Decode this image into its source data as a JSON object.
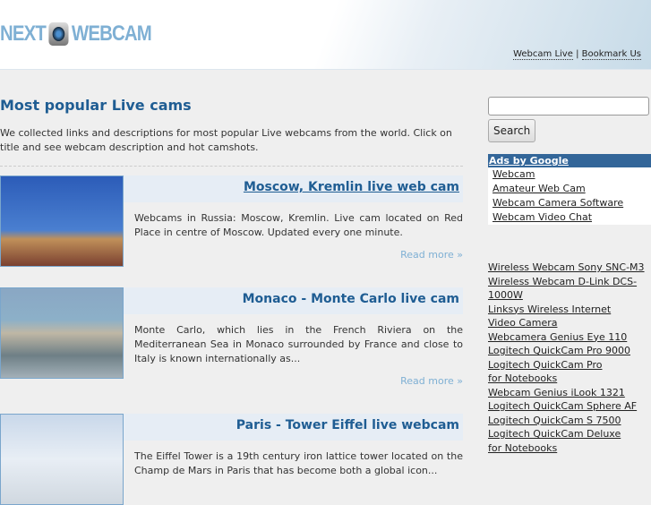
{
  "header": {
    "logo_left": "NEXT",
    "logo_right": "WEBCAM",
    "links": [
      "Webcam Live",
      "Bookmark Us"
    ],
    "separator": "|"
  },
  "main": {
    "title": "Most popular Live cams",
    "intro": "We collected links and descriptions for most popular Live webcams from the world. Click on title and see webcam description and hot camshots.",
    "items": [
      {
        "title": "Moscow, Kremlin live web cam",
        "desc": "Webcams in Russia: Moscow, Kremlin. Live cam located on Red Place in centre of Moscow. Updated every one minute.",
        "more": "Read more »"
      },
      {
        "title": "Monaco - Monte Carlo live cam",
        "desc": "Monte Carlo, which lies in the French Riviera on the Mediterranean Sea in Monaco surrounded by France and close to Italy is known internationally as...",
        "more": "Read more »"
      },
      {
        "title": "Paris - Tower Eiffel live webcam",
        "desc": "The Eiffel Tower is a 19th century iron lattice tower located on the Champ de Mars in Paris that has become both a global icon..."
      }
    ]
  },
  "sidebar": {
    "search_value": "",
    "search_button": "Search",
    "ads_header": "Ads by Google",
    "ads": [
      "Webcam",
      "Amateur Web Cam",
      "Webcam Camera Software",
      "Webcam Video Chat"
    ],
    "links": [
      "Wireless Webcam Sony SNC-M3",
      "Wireless Webcam D-Link DCS-\n1000W",
      "Linksys Wireless Internet\nVideo Camera",
      "Webcamera Genius Eye 110",
      "Logitech QuickCam Pro 9000",
      "Logitech QuickCam Pro\nfor Notebooks",
      "Webcam Genius iLook 1321",
      "Logitech QuickCam Sphere AF",
      "Logitech QuickCam S 7500",
      "Logitech QuickCam Deluxe\nfor Notebooks"
    ]
  }
}
